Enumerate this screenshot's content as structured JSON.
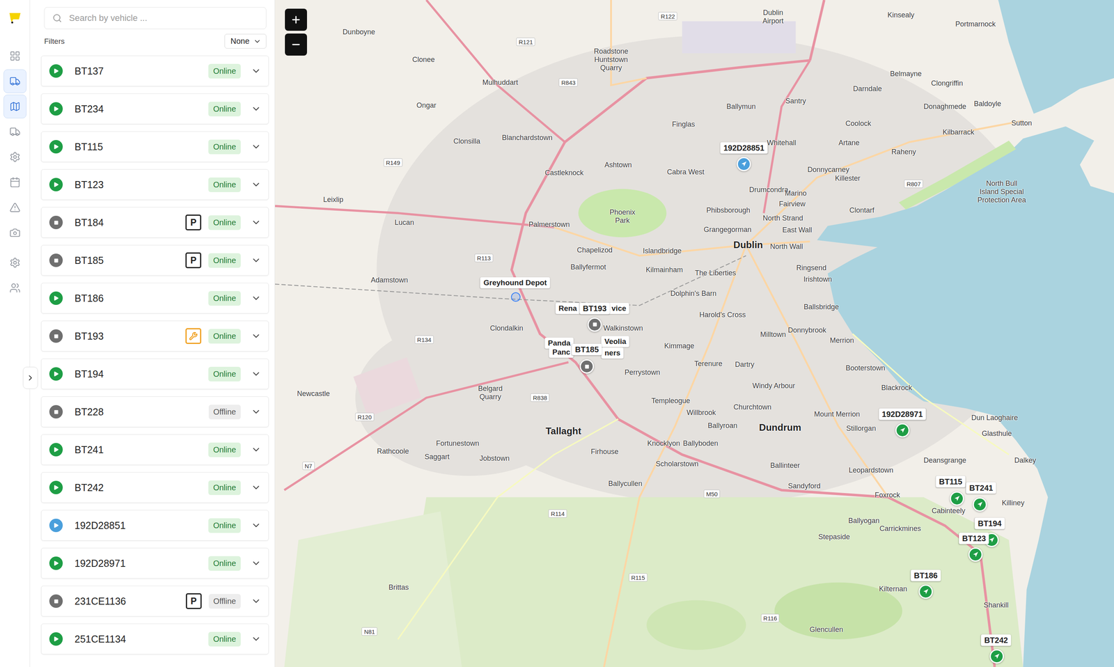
{
  "nav": [
    {
      "selected": false
    },
    {
      "selected": true
    },
    {
      "selected": true
    },
    {
      "selected": false
    },
    {
      "selected": false
    },
    {
      "selected": false
    },
    {
      "selected": false
    },
    {
      "selected": false
    },
    {
      "selected": false
    },
    {
      "selected": false
    }
  ],
  "search": {
    "placeholder": "Search by vehicle ..."
  },
  "filters": {
    "label": "Filters",
    "value": "None"
  },
  "vehicles": [
    {
      "name": "BT137",
      "moving": true,
      "color": "#1e9e45",
      "badge": null,
      "status": "Online",
      "online": true
    },
    {
      "name": "BT234",
      "moving": true,
      "color": "#1e9e45",
      "badge": null,
      "status": "Online",
      "online": true
    },
    {
      "name": "BT115",
      "moving": true,
      "color": "#1e9e45",
      "badge": null,
      "status": "Online",
      "online": true
    },
    {
      "name": "BT123",
      "moving": true,
      "color": "#1e9e45",
      "badge": null,
      "status": "Online",
      "online": true
    },
    {
      "name": "BT184",
      "moving": false,
      "color": "#6f6f6f",
      "badge": {
        "kind": "parked",
        "text": "P"
      },
      "status": "Online",
      "online": true
    },
    {
      "name": "BT185",
      "moving": false,
      "color": "#6f6f6f",
      "badge": {
        "kind": "parked",
        "text": "P"
      },
      "status": "Online",
      "online": true
    },
    {
      "name": "BT186",
      "moving": true,
      "color": "#1e9e45",
      "badge": null,
      "status": "Online",
      "online": true
    },
    {
      "name": "BT193",
      "moving": false,
      "color": "#6f6f6f",
      "badge": {
        "kind": "maintenance",
        "text": ""
      },
      "status": "Online",
      "online": true
    },
    {
      "name": "BT194",
      "moving": true,
      "color": "#1e9e45",
      "badge": null,
      "status": "Online",
      "online": true
    },
    {
      "name": "BT228",
      "moving": false,
      "color": "#6f6f6f",
      "badge": null,
      "status": "Offline",
      "online": false
    },
    {
      "name": "BT241",
      "moving": true,
      "color": "#1e9e45",
      "badge": null,
      "status": "Online",
      "online": true
    },
    {
      "name": "BT242",
      "moving": true,
      "color": "#1e9e45",
      "badge": null,
      "status": "Online",
      "online": true
    },
    {
      "name": "192D28851",
      "moving": true,
      "color": "#4a9fdc",
      "badge": null,
      "status": "Online",
      "online": true
    },
    {
      "name": "192D28971",
      "moving": true,
      "color": "#1e9e45",
      "badge": null,
      "status": "Online",
      "online": true
    },
    {
      "name": "231CE1136",
      "moving": false,
      "color": "#6f6f6f",
      "badge": {
        "kind": "parked",
        "text": "P"
      },
      "status": "Offline",
      "online": false
    },
    {
      "name": "251CE1134",
      "moving": true,
      "color": "#1e9e45",
      "badge": null,
      "status": "Online",
      "online": true
    }
  ],
  "map": {
    "places": [
      "Dunboyne",
      "Clonee",
      "Mulhuddart",
      "Ongar",
      "Blanchardstown",
      "Clonsilla",
      "Castleknock",
      "Ashtown",
      "Finglas",
      "Ballymun",
      "Santry",
      "Whitehall",
      "Coolock",
      "Darndale",
      "Belmayne",
      "Kinsealy",
      "Portmarnock",
      "Clongriffin",
      "Donaghmede",
      "Baldoyle",
      "Sutton",
      "Kilbarrack",
      "Raheny",
      "Artane",
      "Donnycarney",
      "Killester",
      "Drumcondra",
      "Marino",
      "Fairview",
      "Clontarf",
      "Cabra West",
      "Phibsborough",
      "Grangegorman",
      "North Strand",
      "East Wall",
      "North Wall",
      "Dublin",
      "Leixlip",
      "Lucan",
      "Palmerstown",
      "Phoenix Park",
      "Chapelizod",
      "Islandbridge",
      "Kilmainham",
      "The Liberties",
      "Ringsend",
      "Irishtown",
      "Ballyfermot",
      "Adamstown",
      "Dolphin's Barn",
      "Harold's Cross",
      "Ballsbridge",
      "Donnybrook",
      "Clondalkin",
      "Walkinstown",
      "Kimmage",
      "Merrion",
      "Milltown",
      "Terenure",
      "Dartry",
      "Perrystown",
      "Booterstown",
      "Newcastle",
      "Templeogue",
      "Windy Arbour",
      "Churchtown",
      "Blackrock",
      "Dun Laoghaire",
      "Glasthule",
      "Mount Merrion",
      "Stillorgan",
      "Willbrook",
      "Ballyroan",
      "Dundrum",
      "Deansgrange",
      "Dalkey",
      "Tallaght",
      "Fortunestown",
      "Jobstown",
      "Firhouse",
      "Knocklyon",
      "Ballyboden",
      "Scholarstown",
      "Ballinteer",
      "Leopardstown",
      "Sandyford",
      "Foxrock",
      "Cabinteely",
      "Killiney",
      "Rathcoole",
      "Saggart",
      "Ballycullen",
      "Ballyogan",
      "Carrickmines",
      "Stepaside",
      "Shankill",
      "Kilternan",
      "Glencullen",
      "Brittas",
      "Dublin Airport",
      "Roadstone Huntstown Quarry",
      "Belgard Quarry",
      "North Bull Island Special Protection Area"
    ],
    "roads": [
      "R122",
      "R121",
      "R843",
      "R149",
      "R113",
      "R134",
      "R838",
      "R120",
      "N7",
      "R114",
      "R115",
      "R116",
      "M50",
      "R807",
      "N81"
    ],
    "geofences": [
      {
        "label": "Greyhound Depot",
        "marker": true
      },
      {
        "label": "Rena",
        "marker": false
      },
      {
        "label": "vice",
        "marker": false
      },
      {
        "label": "Panda",
        "marker": false
      },
      {
        "label": "Veolia",
        "marker": false
      },
      {
        "label": "Panc",
        "marker": false
      },
      {
        "label": "ners",
        "marker": false
      }
    ],
    "pins": [
      {
        "label": "192D28851",
        "moving": true,
        "color": "#4a9fdc"
      },
      {
        "label": "BT193",
        "moving": false,
        "color": "#6f6f6f"
      },
      {
        "label": "BT185",
        "moving": false,
        "color": "#6f6f6f"
      },
      {
        "label": "192D28971",
        "moving": true,
        "color": "#1e9e45"
      },
      {
        "label": "BT115",
        "moving": true,
        "color": "#1e9e45"
      },
      {
        "label": "BT241",
        "moving": true,
        "color": "#1e9e45"
      },
      {
        "label": "BT194",
        "moving": true,
        "color": "#1e9e45"
      },
      {
        "label": "BT123",
        "moving": true,
        "color": "#1e9e45"
      },
      {
        "label": "BT186",
        "moving": true,
        "color": "#1e9e45"
      },
      {
        "label": "BT242",
        "moving": true,
        "color": "#1e9e45"
      }
    ]
  }
}
